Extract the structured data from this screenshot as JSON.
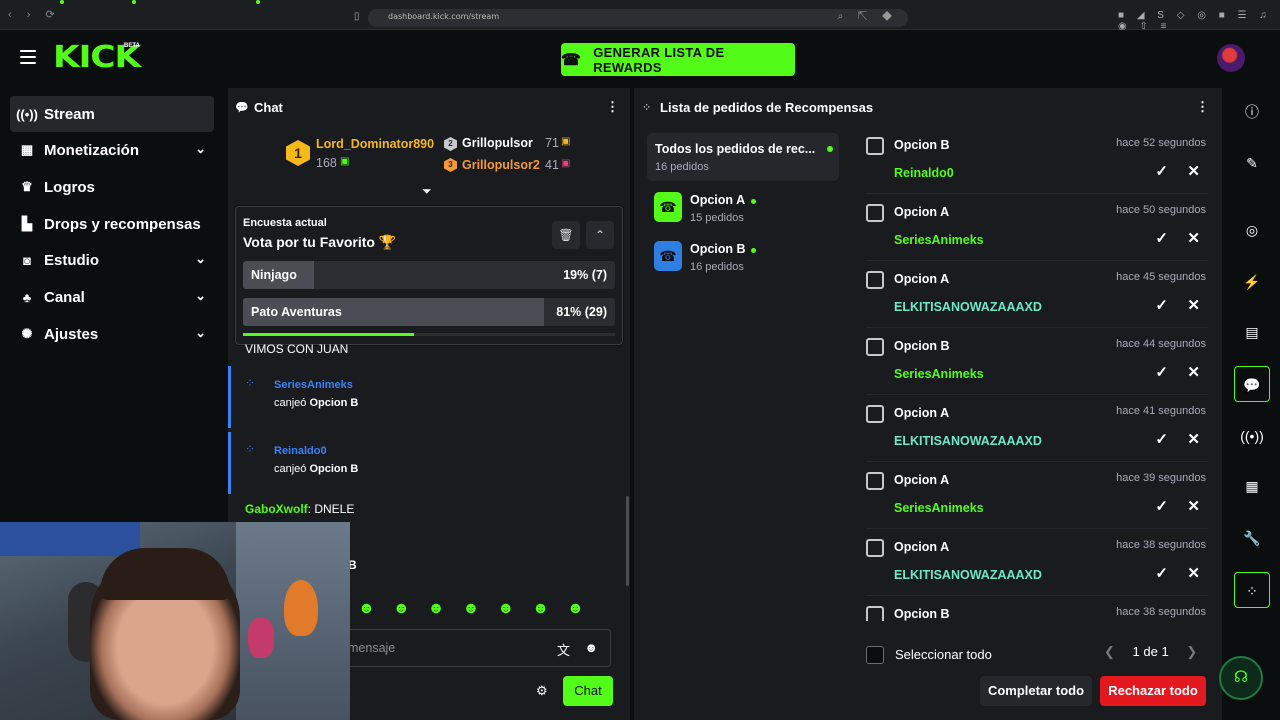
{
  "browser": {
    "url": "dashboard.kick.com/stream"
  },
  "header": {
    "logo": "KICK",
    "logo_badge": "BETA",
    "rewards_button": "GENERAR LISTA DE REWARDS"
  },
  "sidebar": {
    "items": [
      {
        "label": "Stream",
        "icon": "stream-icon"
      },
      {
        "label": "Monetización",
        "icon": "monetization-icon"
      },
      {
        "label": "Logros",
        "icon": "trophy-icon"
      },
      {
        "label": "Drops y recompensas",
        "icon": "drops-icon"
      },
      {
        "label": "Estudio",
        "icon": "studio-icon"
      },
      {
        "label": "Canal",
        "icon": "channel-icon"
      },
      {
        "label": "Ajustes",
        "icon": "settings-icon"
      }
    ]
  },
  "chat": {
    "title": "Chat",
    "leaderboard": {
      "first": {
        "rank": "1",
        "name": "Lord_Dominator890",
        "count": "168"
      },
      "second": {
        "rank": "2",
        "name": "Grillopulsor",
        "count": "71"
      },
      "third": {
        "rank": "3",
        "name": "Grillopulsor2",
        "count": "41"
      }
    },
    "poll": {
      "subtitle": "Encuesta actual",
      "title": "Vota por tu Favorito 🏆",
      "options": [
        {
          "name": "Ninjago",
          "result": "19% (7)",
          "percent": 19
        },
        {
          "name": "Pato Aventuras",
          "result": "81% (29)",
          "percent": 81
        }
      ],
      "time_progress": 0.46
    },
    "partial_message": "VIMOS CON JUAN",
    "redemptions": [
      {
        "user": "SeriesAnimeks",
        "action": "canjeó",
        "reward": "Opcion B"
      },
      {
        "user": "Reinaldo0",
        "action": "canjeó",
        "reward": "Opcion B"
      }
    ],
    "message": {
      "user": "GaboXwolf",
      "text": "DNELE"
    },
    "partial_letter": "B",
    "input_placeholder": "mensaje",
    "send_label": "Chat"
  },
  "rewards": {
    "title": "Lista de pedidos de Recompensas",
    "all_requests": {
      "label": "Todos los pedidos de rec...",
      "count": "16 pedidos"
    },
    "categories": [
      {
        "label": "Opcion A",
        "count": "15 pedidos",
        "color": "#53fc18"
      },
      {
        "label": "Opcion B",
        "count": "16 pedidos",
        "color": "#2f7fe3"
      }
    ],
    "requests": [
      {
        "option": "Opcion B",
        "time": "hace 52 segundos",
        "user": "Reinaldo0",
        "color": "green"
      },
      {
        "option": "Opcion A",
        "time": "hace 50 segundos",
        "user": "SeriesAnimeks",
        "color": "green"
      },
      {
        "option": "Opcion A",
        "time": "hace 45 segundos",
        "user": "ELKITISANOWAZAAAXD",
        "color": "teal"
      },
      {
        "option": "Opcion B",
        "time": "hace 44 segundos",
        "user": "SeriesAnimeks",
        "color": "green"
      },
      {
        "option": "Opcion A",
        "time": "hace 41 segundos",
        "user": "ELKITISANOWAZAAAXD",
        "color": "teal"
      },
      {
        "option": "Opcion A",
        "time": "hace 39 segundos",
        "user": "SeriesAnimeks",
        "color": "green"
      },
      {
        "option": "Opcion A",
        "time": "hace 38 segundos",
        "user": "ELKITISANOWAZAAAXD",
        "color": "teal"
      },
      {
        "option": "Opcion B",
        "time": "hace 38 segundos",
        "user": "",
        "color": "green"
      }
    ],
    "select_all": "Seleccionar todo",
    "page": "1 de 1",
    "complete_all": "Completar todo",
    "reject_all": "Rechazar todo"
  },
  "colors": {
    "brand": "#53fc18",
    "reject": "#e3191f",
    "redeem_accent": "#3b82f6"
  }
}
